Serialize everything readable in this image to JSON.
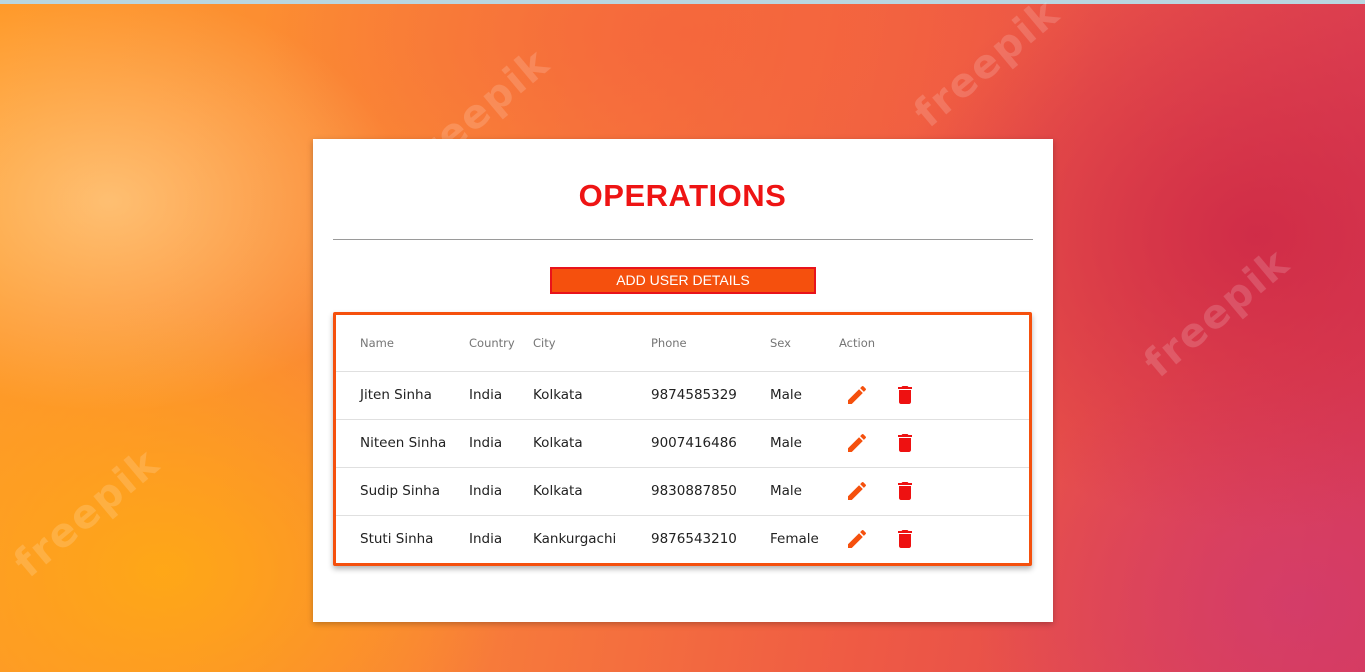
{
  "page": {
    "title": "OPERATIONS",
    "add_button_label": "ADD USER DETAILS",
    "watermark_text": "freepik"
  },
  "colors": {
    "accent": "#f5500d",
    "title_red": "#ee1414",
    "delete_red": "#ee1111"
  },
  "table": {
    "headers": {
      "name": "Name",
      "country": "Country",
      "city": "City",
      "phone": "Phone",
      "sex": "Sex",
      "action": "Action"
    },
    "rows": [
      {
        "name": "Jiten Sinha",
        "country": "India",
        "city": "Kolkata",
        "phone": "9874585329",
        "sex": "Male"
      },
      {
        "name": "Niteen Sinha",
        "country": "India",
        "city": "Kolkata",
        "phone": "9007416486",
        "sex": "Male"
      },
      {
        "name": "Sudip Sinha",
        "country": "India",
        "city": "Kolkata",
        "phone": "9830887850",
        "sex": "Male"
      },
      {
        "name": "Stuti Sinha",
        "country": "India",
        "city": "Kankurgachi",
        "phone": "9876543210",
        "sex": "Female"
      }
    ],
    "row_actions": {
      "edit_icon": "pencil-icon",
      "delete_icon": "trash-icon"
    }
  }
}
